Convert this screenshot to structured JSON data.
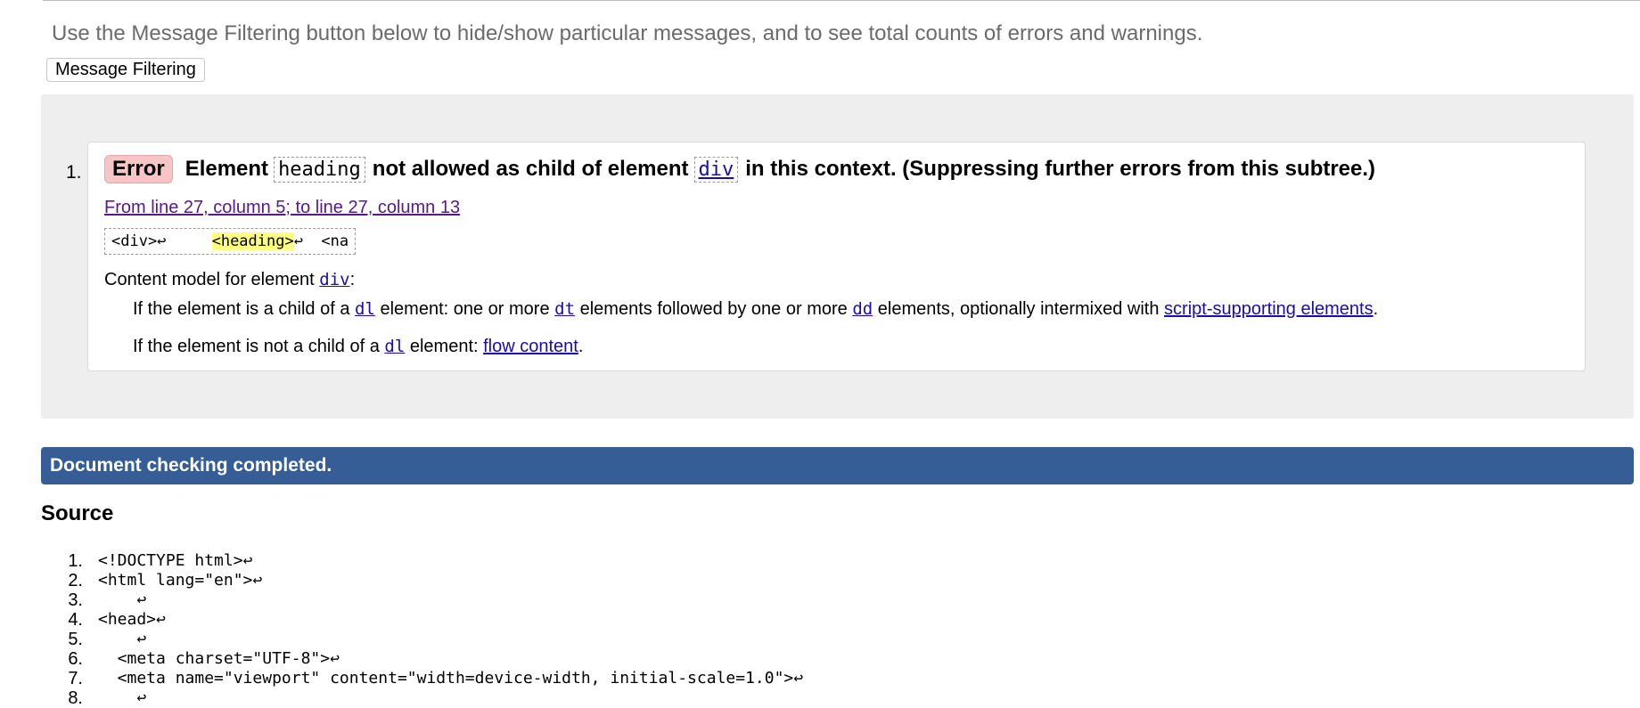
{
  "intro_text": "Use the Message Filtering button below to hide/show particular messages, and to see total counts of errors and warnings.",
  "filter_button": "Message Filtering",
  "message": {
    "number": "1.",
    "badge": "Error",
    "text_before": "Element",
    "element_code": "heading",
    "text_middle": "not allowed as child of element",
    "parent_code": "div",
    "text_after": "in this context. (Suppressing further errors from this subtree.)",
    "location": "From line 27, column 5; to line 27, column 13",
    "extract_before": "<div>↩     ",
    "extract_highlight": "<heading>",
    "extract_after": "↩  <na",
    "content_model_prefix": "Content model for element",
    "content_model_element": "div",
    "content_model_suffix": ":",
    "rule1": {
      "a": "If the element is a child of a",
      "el1": "dl",
      "b": "element: one or more",
      "el2": "dt",
      "c": "elements followed by one or more",
      "el3": "dd",
      "d": "elements, optionally intermixed with",
      "link": "script-supporting elements",
      "e": "."
    },
    "rule2": {
      "a": "If the element is not a child of a",
      "el1": "dl",
      "b": "element:",
      "link": "flow content",
      "c": "."
    }
  },
  "completed_text": "Document checking completed.",
  "source_title": "Source",
  "source_lines": [
    {
      "n": "1.",
      "code": "<!DOCTYPE html>↩"
    },
    {
      "n": "2.",
      "code": "<html lang=\"en\">↩"
    },
    {
      "n": "3.",
      "code": "    ↩"
    },
    {
      "n": "4.",
      "code": "<head>↩"
    },
    {
      "n": "5.",
      "code": "    ↩"
    },
    {
      "n": "6.",
      "code": "  <meta charset=\"UTF-8\">↩"
    },
    {
      "n": "7.",
      "code": "  <meta name=\"viewport\" content=\"width=device-width, initial-scale=1.0\">↩"
    },
    {
      "n": "8.",
      "code": "    ↩"
    }
  ]
}
